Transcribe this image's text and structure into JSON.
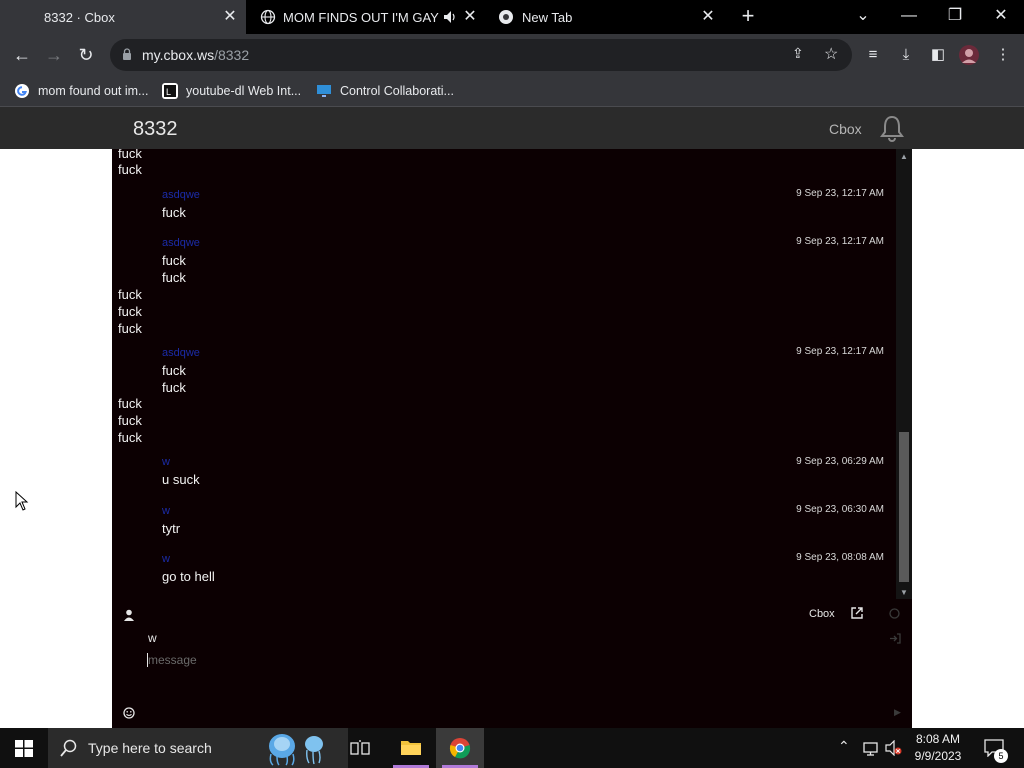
{
  "browser": {
    "tabs": [
      {
        "title": "8332 · Cbox",
        "active": true
      },
      {
        "title": "MOM FINDS OUT I'M GAY o",
        "active": false,
        "audio": true
      },
      {
        "title": "New Tab",
        "active": false
      }
    ],
    "url_host": "my.cbox.ws",
    "url_path": "/8332",
    "bookmarks": [
      {
        "label": "mom found out im...",
        "icon": "google-icon"
      },
      {
        "label": "youtube-dl Web Int...",
        "icon": "youtube-dl-icon"
      },
      {
        "label": "Control Collaborati...",
        "icon": "monitor-icon"
      }
    ]
  },
  "cbox": {
    "title": "8332",
    "brand": "Cbox",
    "messages": [
      {
        "kind": "text",
        "text": "fuck"
      },
      {
        "kind": "text",
        "text": "fuck"
      },
      {
        "kind": "post",
        "name": "asdqwe",
        "time": "9 Sep 23, 12:17 AM",
        "text": "fuck"
      },
      {
        "kind": "post",
        "name": "asdqwe",
        "time": "9 Sep 23, 12:17 AM",
        "text": "fuck"
      },
      {
        "kind": "text",
        "text": "fuck"
      },
      {
        "kind": "text",
        "text": "fuck"
      },
      {
        "kind": "text",
        "text": "fuck"
      },
      {
        "kind": "text",
        "text": "fuck"
      },
      {
        "kind": "post",
        "name": "asdqwe",
        "time": "9 Sep 23, 12:17 AM",
        "text": "fuck"
      },
      {
        "kind": "text",
        "text": "fuck"
      },
      {
        "kind": "text",
        "text": "fuck"
      },
      {
        "kind": "text",
        "text": "fuck"
      },
      {
        "kind": "text",
        "text": "fuck"
      },
      {
        "kind": "post",
        "name": "w",
        "time": "9 Sep 23, 06:29 AM",
        "text": "u suck"
      },
      {
        "kind": "post",
        "name": "w",
        "time": "9 Sep 23, 06:30 AM",
        "text": "tytr"
      },
      {
        "kind": "post",
        "name": "w",
        "time": "9 Sep 23, 08:08 AM",
        "text": "go to hell"
      }
    ],
    "footer": {
      "brand": "Cbox",
      "username": "w",
      "message_placeholder": "message"
    }
  },
  "taskbar": {
    "search_placeholder": "Type here to search",
    "time": "8:08 AM",
    "date": "9/9/2023",
    "notification_count": "5"
  },
  "colors": {
    "chat_bg": "#0c0002",
    "name_color": "#1b2ba8",
    "header_bg": "#2b2b2b"
  }
}
